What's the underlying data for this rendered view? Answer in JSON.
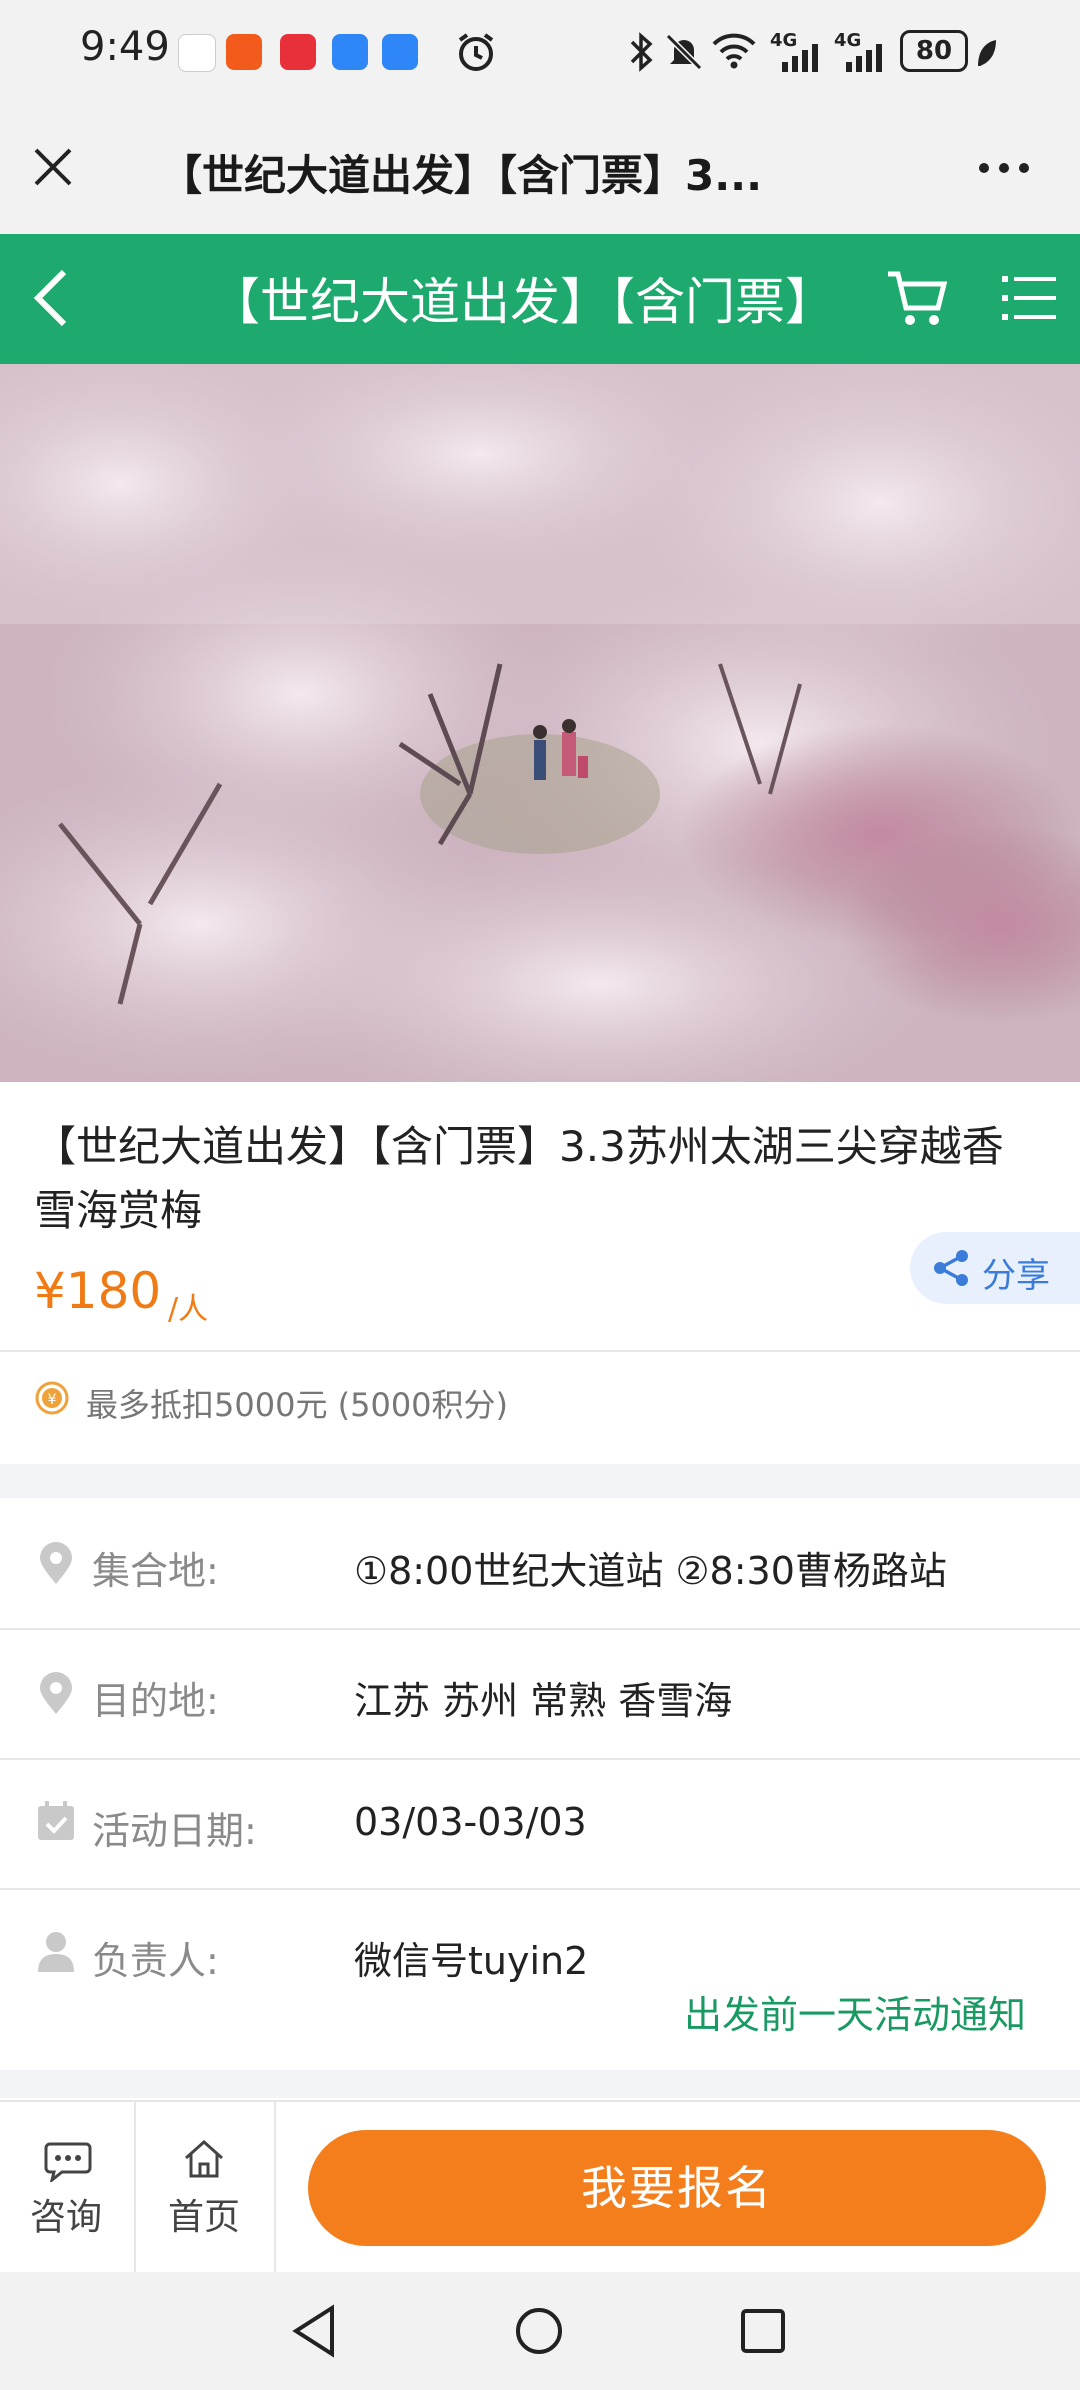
{
  "status_bar": {
    "time": "9:49",
    "network_1": "4G",
    "network_2": "4G",
    "battery": "80"
  },
  "browser": {
    "title": "【世纪大道出发】【含门票】3..."
  },
  "header": {
    "title": "【世纪大道出发】【含门票】"
  },
  "product": {
    "title": "【世纪大道出发】【含门票】3.3苏州太湖三尖穿越香雪海赏梅",
    "price": "¥180",
    "price_unit": "/人",
    "share_label": "分享",
    "credit_note": "最多抵扣5000元 (5000积分)"
  },
  "details": [
    {
      "label": "集合地:",
      "value": "①8:00世纪大道站 ②8:30曹杨路站",
      "icon": "location-icon"
    },
    {
      "label": "目的地:",
      "value": "江苏 苏州 常熟 香雪海",
      "icon": "location-icon"
    },
    {
      "label": "活动日期:",
      "value": "03/03-03/03",
      "icon": "calendar-icon"
    },
    {
      "label": "负责人:",
      "value": "微信号tuyin2",
      "icon": "person-icon"
    }
  ],
  "notice": "出发前一天活动通知",
  "actions": {
    "consult": "咨询",
    "home": "首页",
    "signup": "我要报名"
  },
  "colors": {
    "header_green": "#1eaa6e",
    "accent_orange": "#f47e1c",
    "price_orange": "#f07b15",
    "notice_green": "#1a9a63"
  }
}
